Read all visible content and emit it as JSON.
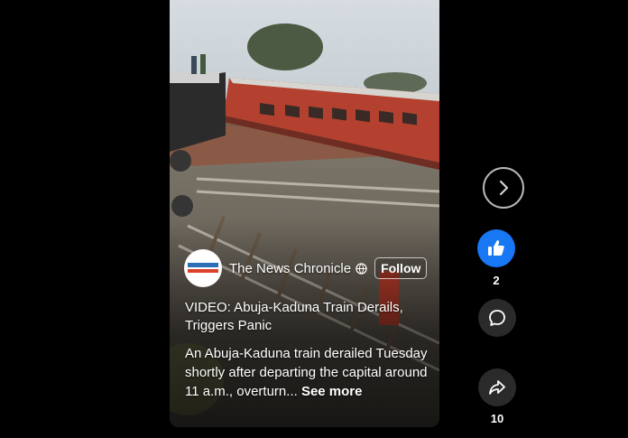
{
  "channel": {
    "name": "The News Chronicle",
    "follow_label": "Follow"
  },
  "post": {
    "title": "VIDEO: Abuja-Kaduna Train Derails, Triggers Panic",
    "description": "An Abuja-Kaduna train derailed Tuesday shortly after departing the capital around 11 a.m., overturn...",
    "see_more_label": "See more"
  },
  "actions": {
    "like_count": "2",
    "share_count": "10"
  },
  "icons": {
    "next": "chevron-right-icon",
    "like": "thumbs-up-icon",
    "comment": "comment-icon",
    "share": "share-icon",
    "globe": "globe-icon"
  },
  "colors": {
    "like_blue": "#1877f2",
    "train_red": "#b4412f"
  }
}
